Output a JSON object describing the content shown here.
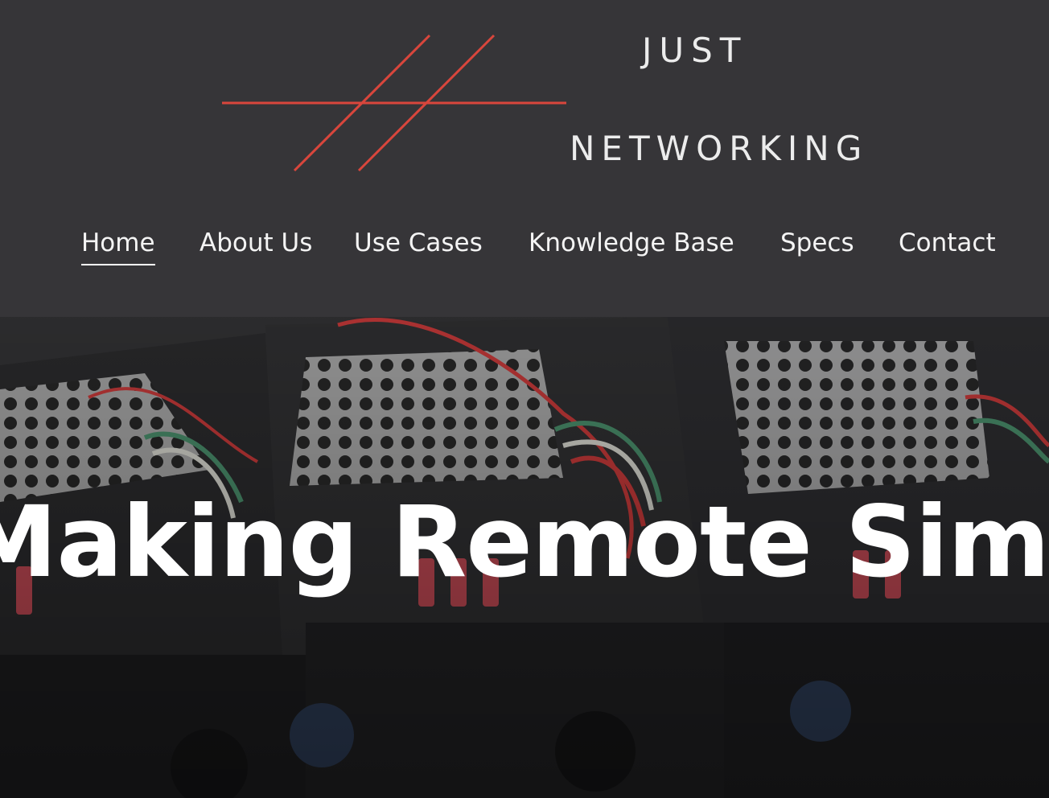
{
  "brand": {
    "line1": "JUST",
    "line2": "NETWORKING",
    "accent_color": "#d9463c"
  },
  "nav": {
    "items": [
      {
        "label": "Home",
        "active": true
      },
      {
        "label": "About Us"
      },
      {
        "label": "Use Cases"
      },
      {
        "label": "Knowledge Base"
      },
      {
        "label": "Specs"
      },
      {
        "label": "Contact"
      }
    ]
  },
  "hero": {
    "title": "Making Remote Simple",
    "image_icon": "hardware-photo"
  },
  "colors": {
    "header_bg": "#363538",
    "text": "#f4f4f4"
  }
}
